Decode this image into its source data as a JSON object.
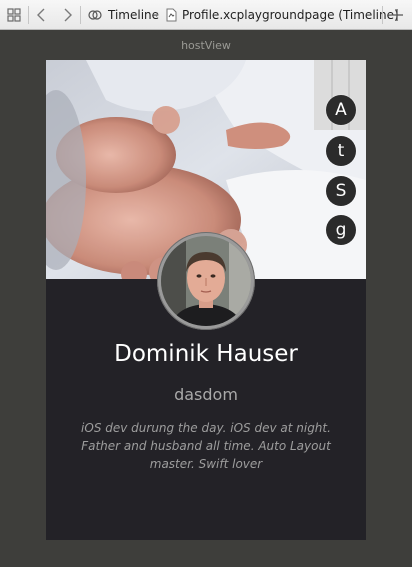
{
  "toolbar": {
    "timeline_label": "Timeline",
    "file_label": "Profile.xcplaygroundpage (Timeline)"
  },
  "host_view_label": "hostView",
  "profile": {
    "name": "Dominik Hauser",
    "handle": "dasdom",
    "bio": "iOS dev durung the day. iOS dev at night. Father and husband all time. Auto Layout master. Swift lover",
    "social_buttons": [
      {
        "label": "A",
        "icon": "app-dot-net-icon"
      },
      {
        "label": "t",
        "icon": "twitter-icon"
      },
      {
        "label": "S",
        "icon": "stackoverflow-icon"
      },
      {
        "label": "g",
        "icon": "github-icon"
      }
    ]
  }
}
